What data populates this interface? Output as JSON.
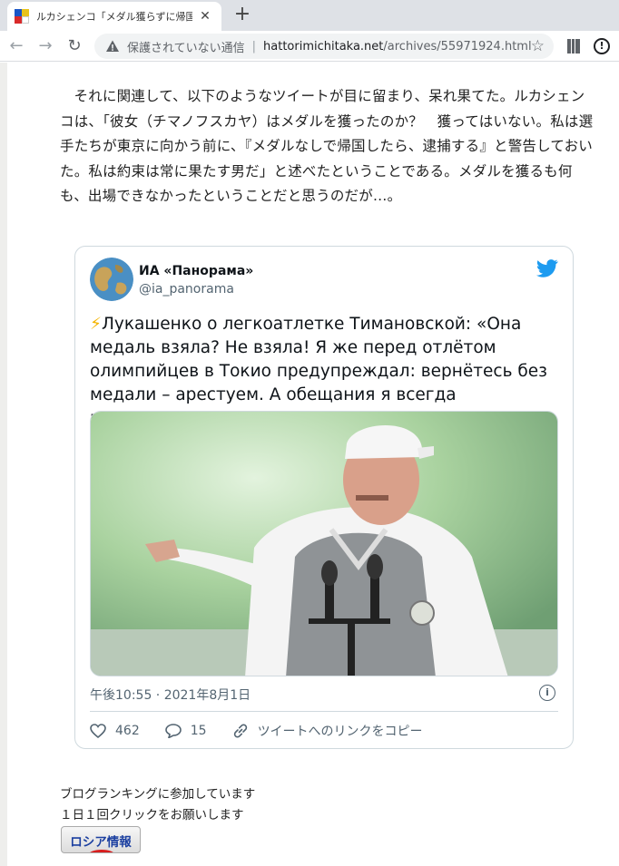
{
  "browser": {
    "tab_title": "ルカシェンコ「メダル獲らずに帰国した選手は逮捕」",
    "tab_close_icon": "close-icon",
    "new_tab_icon": "plus-icon",
    "security_label": "保護されていない通信",
    "url_host": "hattorimichitaka.net",
    "url_path": "/archives/55971924.html"
  },
  "article": {
    "paragraph": "それに関連して、以下のようなツイートが目に留まり、呆れ果てた。ルカシェンコは、「彼女（チマノフスカヤ）はメダルを獲ったのか？　獲ってはいない。私は選手たちが東京に向かう前に、『メダルなしで帰国したら、逮捕する』と警告しておいた。私は約束は常に果たす男だ」と述べたということである。メダルを獲るも何も、出場できなかったということだと思うのだが…。"
  },
  "tweet": {
    "name": "ИА «Панорама»",
    "handle": "@ia_panorama",
    "bolt": "⚡",
    "text": "Лукашенко о легкоатлетке Тимановской: «Она медаль взяла? Не взяла! Я же перед отлётом олимпийцев в Токио предупреждал: вернётесь без медали – арестуем. А обещания я всегда выполняю».",
    "time": "午後10:55 · 2021年8月1日",
    "likes": "462",
    "replies": "15",
    "copy_link": "ツイートへのリンクをコピー"
  },
  "footer": {
    "ranking_line1": "ブログランキングに参加しています",
    "ranking_line2": "１日１回クリックをお願いします",
    "banner_label": "ロシア情報"
  },
  "colors": {
    "twitter_blue": "#1d9bf0",
    "text_primary": "#0f1419",
    "text_secondary": "#536471"
  }
}
